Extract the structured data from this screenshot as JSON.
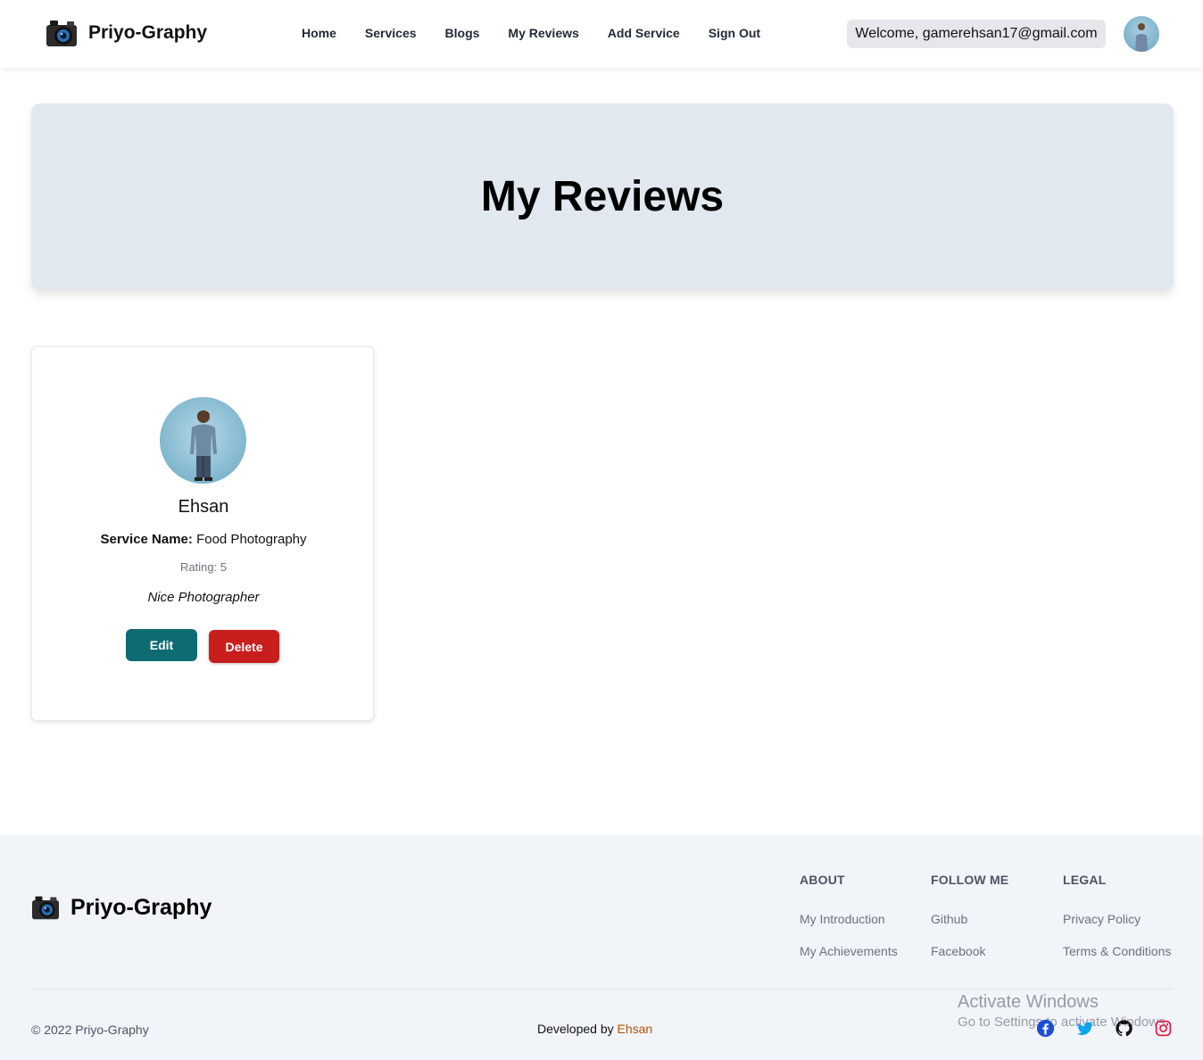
{
  "navbar": {
    "brand": "Priyo-Graphy",
    "links": [
      "Home",
      "Services",
      "Blogs",
      "My Reviews",
      "Add Service",
      "Sign Out"
    ],
    "welcome": "Welcome, gamerehsan17@gmail.com"
  },
  "hero": {
    "title": "My Reviews"
  },
  "review": {
    "name": "Ehsan",
    "service_label": "Service Name:",
    "service_name": "Food Photography",
    "rating": "Rating: 5",
    "text": "Nice Photographer",
    "edit_label": "Edit",
    "delete_label": "Delete"
  },
  "footer": {
    "brand": "Priyo-Graphy",
    "about": {
      "title": "ABOUT",
      "links": [
        "My Introduction",
        "My Achievements"
      ]
    },
    "follow": {
      "title": "FOLLOW ME",
      "links": [
        "Github",
        "Facebook"
      ]
    },
    "legal": {
      "title": "LEGAL",
      "links": [
        "Privacy Policy",
        "Terms & Conditions"
      ]
    },
    "copyright": "© 2022 Priyo-Graphy",
    "developed_prefix": "Developed by",
    "developer": "Ehsan",
    "socials": [
      "facebook-icon",
      "twitter-icon",
      "github-icon",
      "instagram-icon"
    ]
  },
  "watermark": {
    "line1": "Activate Windows",
    "line2": "Go to Settings to activate Windows."
  },
  "colors": {
    "edit": "#0e6b73",
    "delete": "#c81e1e",
    "hero_bg": "#e2e8f0",
    "footer_bg": "#f1f4f9",
    "developer": "#b45309"
  }
}
